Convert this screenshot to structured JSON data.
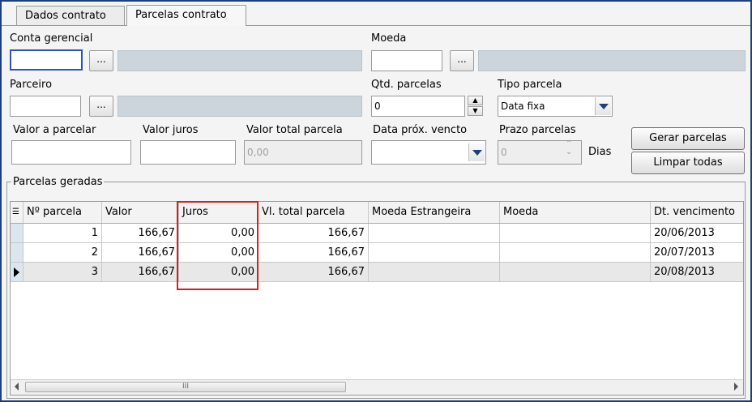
{
  "tabs": [
    {
      "label": "Dados contrato"
    },
    {
      "label": "Parcelas contrato"
    }
  ],
  "form": {
    "conta_gerencial": {
      "label": "Conta gerencial",
      "value": "",
      "lookup_btn": "..."
    },
    "moeda": {
      "label": "Moeda",
      "value": "",
      "lookup_btn": "..."
    },
    "parceiro": {
      "label": "Parceiro",
      "value": "",
      "lookup_btn": "..."
    },
    "qtd_parcelas": {
      "label": "Qtd. parcelas",
      "value": "0"
    },
    "tipo_parcela": {
      "label": "Tipo parcela",
      "value": "Data fixa"
    },
    "valor_a_parcelar": {
      "label": "Valor a parcelar",
      "value": ""
    },
    "valor_juros": {
      "label": "Valor juros",
      "value": ""
    },
    "valor_total_parcela": {
      "label": "Valor total parcela",
      "value": "0,00"
    },
    "data_prox_vencto": {
      "label": "Data próx. vencto",
      "value": ""
    },
    "prazo_parcelas": {
      "label": "Prazo parcelas",
      "value": "0",
      "unit": "Dias"
    },
    "gerar_parcelas": "Gerar parcelas",
    "limpar_todas": "Limpar todas"
  },
  "group": {
    "title": "Parcelas geradas"
  },
  "grid": {
    "columns": [
      "Nº parcela",
      "Valor",
      "Juros",
      "Vl. total parcela",
      "Moeda Estrangeira",
      "Moeda",
      "Dt. vencimento"
    ],
    "rows": [
      {
        "n": "1",
        "valor": "166,67",
        "juros": "0,00",
        "total": "166,67",
        "moeda_est": "",
        "moeda": "",
        "venc": "20/06/2013"
      },
      {
        "n": "2",
        "valor": "166,67",
        "juros": "0,00",
        "total": "166,67",
        "moeda_est": "",
        "moeda": "",
        "venc": "20/07/2013"
      },
      {
        "n": "3",
        "valor": "166,67",
        "juros": "0,00",
        "total": "166,67",
        "moeda_est": "",
        "moeda": "",
        "venc": "20/08/2013"
      }
    ],
    "current_row_index": 2
  },
  "scrollbar": {
    "thumb_grip": "III"
  },
  "colors": {
    "highlight": "#d42020",
    "accent": "#1f3f7a"
  }
}
